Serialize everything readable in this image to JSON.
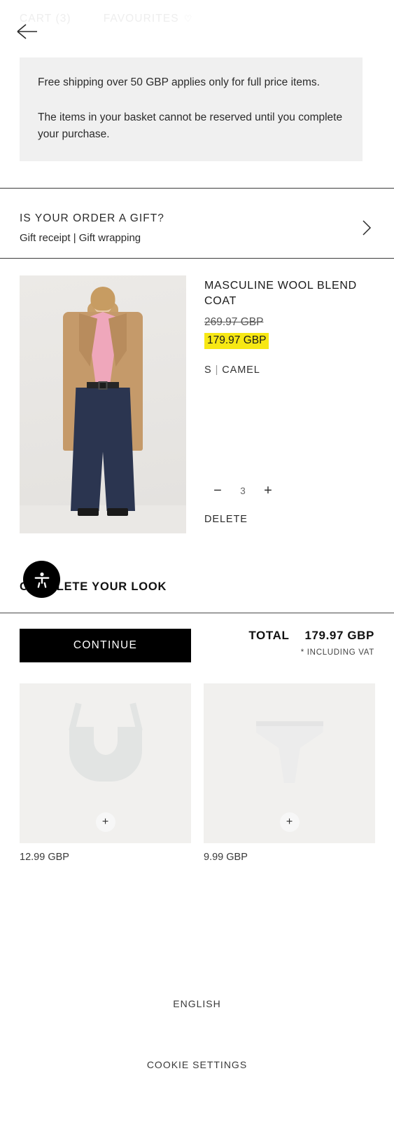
{
  "header": {
    "tabs": [
      {
        "label": "CART (3)",
        "name": "tab-cart"
      },
      {
        "label": "FAVOURITES",
        "name": "tab-favourites"
      }
    ],
    "favourites_icon": "♡",
    "back_icon": "arrow-left-icon"
  },
  "notice": {
    "line1": "Free shipping over 50 GBP applies only for full price items.",
    "line2": "The items in your basket cannot be reserved until you complete your purchase."
  },
  "gift": {
    "title": "IS YOUR ORDER A GIFT?",
    "subtitle": "Gift receipt | Gift wrapping",
    "chevron_icon": "chevron-right-icon"
  },
  "cart_item": {
    "name": "MASCULINE WOOL BLEND COAT",
    "price_original": "269.97 GBP",
    "price_current": "179.97 GBP",
    "size": "S",
    "separator": "|",
    "color": "CAMEL",
    "quantity": "3",
    "decrease_label": "−",
    "increase_label": "+",
    "delete_label": "DELETE",
    "highlight_color": "#f7e814"
  },
  "complete_your_look": {
    "heading": "COMPLETE YOUR LOOK",
    "items": [
      {
        "price": "12.99 GBP",
        "add_label": "+",
        "name": "suggestion-bra"
      },
      {
        "price": "9.99 GBP",
        "add_label": "+",
        "name": "suggestion-briefs"
      }
    ]
  },
  "checkout": {
    "continue_label": "CONTINUE",
    "total_label": "TOTAL",
    "total_value": "179.97 GBP",
    "vat_note": "* INCLUDING VAT"
  },
  "footer": {
    "language": "ENGLISH",
    "cookie_settings": "COOKIE SETTINGS"
  },
  "accessibility_widget": {
    "icon": "accessibility-person-icon"
  }
}
